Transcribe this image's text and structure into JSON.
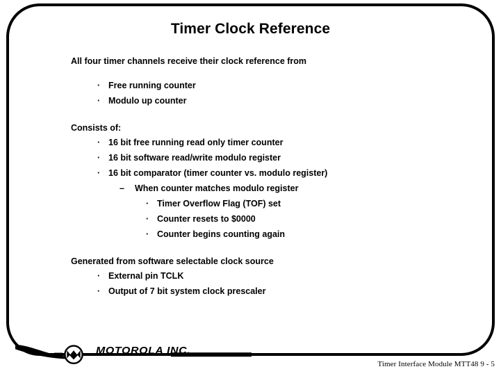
{
  "slide": {
    "title": "Timer Clock Reference",
    "frame_color": "#000000",
    "background_color": "#ffffff",
    "text_color": "#000000"
  },
  "bullets": {
    "square": "·",
    "dash": "–"
  },
  "content": [
    {
      "level": 0,
      "text": "All four timer channels receive their clock reference from"
    },
    {
      "level": 1,
      "text": "Free running counter"
    },
    {
      "level": 1,
      "text": "Modulo up counter"
    },
    {
      "level": 0,
      "text": "Consists of:"
    },
    {
      "level": 1,
      "text": "16 bit free running read only timer counter"
    },
    {
      "level": 1,
      "text": "16 bit software read/write modulo register"
    },
    {
      "level": 1,
      "text": "16 bit comparator (timer counter vs. modulo register)"
    },
    {
      "level": 2,
      "text": "When counter matches modulo register"
    },
    {
      "level": 3,
      "text": "Timer Overflow Flag (TOF) set"
    },
    {
      "level": 3,
      "text": "Counter resets to $0000"
    },
    {
      "level": 3,
      "text": "Counter begins counting again"
    },
    {
      "level": 0,
      "text": "Generated from software selectable clock source"
    },
    {
      "level": 1,
      "text": "External pin TCLK"
    },
    {
      "level": 1,
      "text": "Output of 7 bit system clock prescaler"
    }
  ],
  "logo": {
    "wordmark": "MOTOROLA INC.",
    "emblem_name": "motorola-batwing-logo"
  },
  "footer": {
    "reference": "Timer Interface Module MTT48  9 - 5"
  }
}
